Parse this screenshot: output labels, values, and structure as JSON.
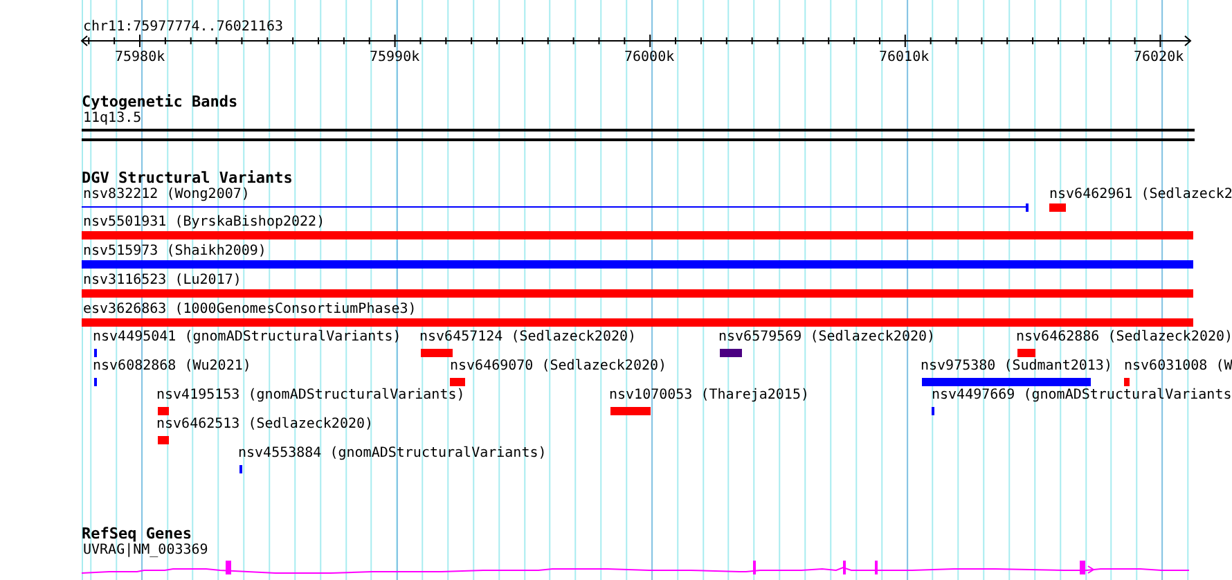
{
  "ruler": {
    "location": "chr11:75977774..76021163",
    "ticks": [
      "75980k",
      "75990k",
      "76000k",
      "76010k",
      "76020k"
    ]
  },
  "tracks": [
    {
      "kind": "cytoband",
      "title": "Cytogenetic Bands",
      "features": [
        {
          "label": "11q13.5"
        }
      ]
    },
    {
      "kind": "variants",
      "title": "DGV Structural Variants",
      "features": [
        {
          "label": "nsv832212 (Wong2007)",
          "kind": "line",
          "color": "#0000ff"
        },
        {
          "label": "nsv6462961 (Sedlazeck2",
          "kind": "bar",
          "color": "#ff0000"
        },
        {
          "label": "nsv5501931 (ByrskaBishop2022)",
          "kind": "bar",
          "color": "#ff0000"
        },
        {
          "label": "nsv515973 (Shaikh2009)",
          "kind": "bar",
          "color": "#0000ff"
        },
        {
          "label": "nsv3116523 (Lu2017)",
          "kind": "bar",
          "color": "#ff0000"
        },
        {
          "label": "esv3626863 (1000GenomesConsortiumPhase3)",
          "kind": "bar",
          "color": "#ff0000"
        },
        {
          "label": "nsv4495041 (gnomADStructuralVariants)",
          "kind": "bar",
          "color": "#0000ff"
        },
        {
          "label": "nsv6457124 (Sedlazeck2020)",
          "kind": "bar",
          "color": "#ff0000"
        },
        {
          "label": "nsv6579569 (Sedlazeck2020)",
          "kind": "bar",
          "color": "#4b0082"
        },
        {
          "label": "nsv6462886 (Sedlazeck2020)",
          "kind": "bar",
          "color": "#ff0000"
        },
        {
          "label": "nsv6082868 (Wu2021)",
          "kind": "bar",
          "color": "#0000ff"
        },
        {
          "label": "nsv6469070 (Sedlazeck2020)",
          "kind": "bar",
          "color": "#ff0000"
        },
        {
          "label": "nsv975380 (Sudmant2013)",
          "kind": "bar",
          "color": "#0000ff"
        },
        {
          "label": "nsv6031008 (W",
          "kind": "bar",
          "color": "#ff0000"
        },
        {
          "label": "nsv4195153 (gnomADStructuralVariants)",
          "kind": "bar",
          "color": "#ff0000"
        },
        {
          "label": "nsv1070053 (Thareja2015)",
          "kind": "bar",
          "color": "#ff0000"
        },
        {
          "label": "nsv4497669 (gnomADStructuralVariants",
          "kind": "bar",
          "color": "#0000ff"
        },
        {
          "label": "nsv6462513 (Sedlazeck2020)",
          "kind": "bar",
          "color": "#ff0000"
        },
        {
          "label": "nsv4553884 (gnomADStructuralVariants)",
          "kind": "bar",
          "color": "#0000ff"
        }
      ]
    },
    {
      "kind": "genes",
      "title": "RefSeq Genes",
      "features": [
        {
          "label": "UVRAG|NM_003369"
        }
      ]
    }
  ]
}
